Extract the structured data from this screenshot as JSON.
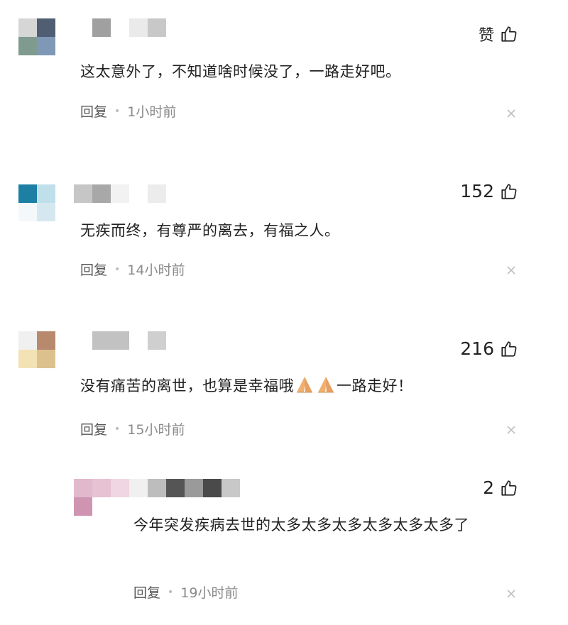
{
  "comments": [
    {
      "likes": "赞",
      "text": "这太意外了，不知道啥时候没了，一路走好吧。",
      "reply_label": "回复",
      "time": "1小时前",
      "avatar_colors": [
        "#d6d6d6",
        "#4f5e73",
        "#7f9a8f",
        "#7f98b5"
      ],
      "name_colors": [
        "#a0a0a0",
        "#ffffff",
        "#eaeaea",
        "#c8c8c8"
      ]
    },
    {
      "likes": "152",
      "text": "无疾而终，有尊严的离去，有福之人。",
      "reply_label": "回复",
      "time": "14小时前",
      "avatar_colors": [
        "#1c7fa3",
        "#bfe0ea",
        "#f4f8fa",
        "#d6e8ef"
      ],
      "name_colors": [
        "#c6c6c6",
        "#a8a8a8",
        "#f2f2f2",
        "#ffffff",
        "#ececec"
      ]
    },
    {
      "likes": "216",
      "text_before": "没有痛苦的离世，也算是幸福哦",
      "text_after": "一路走好！",
      "reply_label": "回复",
      "time": "15小时前",
      "avatar_colors": [
        "#f0f0f0",
        "#b78a6e",
        "#f3e2b3",
        "#dcc18f"
      ],
      "name_colors": [
        "#c2c2c2",
        "#ffffff",
        "#cfcfcf"
      ]
    },
    {
      "likes": "2",
      "text": "今年突发疾病去世的太多太多太多太多太多太多了",
      "reply_label": "回复",
      "time": "19小时前",
      "avatar_colors": [
        "#e2b8cd",
        "#e6c2d3",
        "#f0d6e2",
        "#ffffff"
      ],
      "avatar_bottom_color": "#cf95b0",
      "name_colors": [
        "#f0f0f0",
        "#bdbdbd",
        "#555555",
        "#9a9a9a",
        "#4a4a4a",
        "#c8c8c8"
      ]
    }
  ],
  "icons": {
    "like": "thumbs-up-icon",
    "close": "close-x-icon",
    "emoji": "folded-hands-emoji"
  }
}
